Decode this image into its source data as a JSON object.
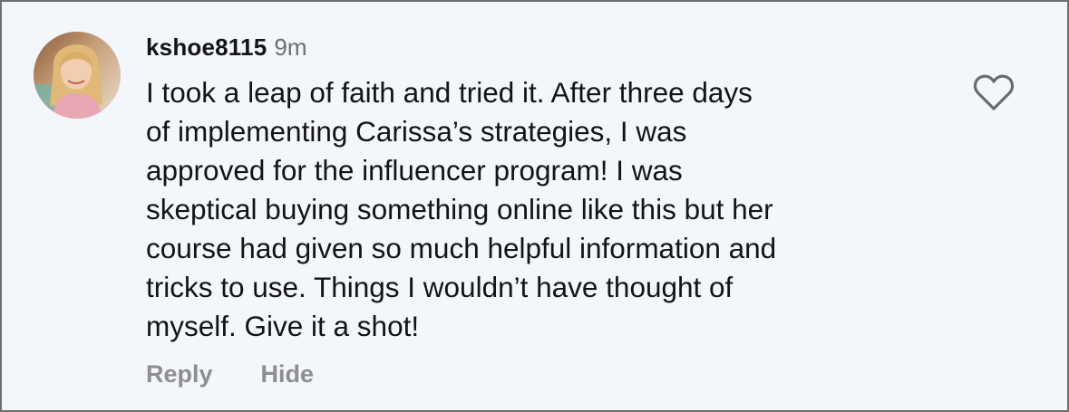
{
  "comment": {
    "username": "kshoe8115",
    "time_ago": "9m",
    "text": "I took a leap of faith and tried it. After three days\nof implementing Carissa’s strategies, I was\napproved for the influencer program! I was\nskeptical buying something online like this but her\ncourse had given so much helpful information and\ntricks to use. Things I wouldn’t have thought of\nmyself. Give it a shot!",
    "avatar_icon": "profile-photo",
    "like_icon": "heart-outline-icon"
  },
  "actions": {
    "reply_label": "Reply",
    "hide_label": "Hide"
  },
  "colors": {
    "background": "#f3f6fb",
    "text": "#141414",
    "muted": "#8e8e8e",
    "border": "#6f6f6f"
  }
}
